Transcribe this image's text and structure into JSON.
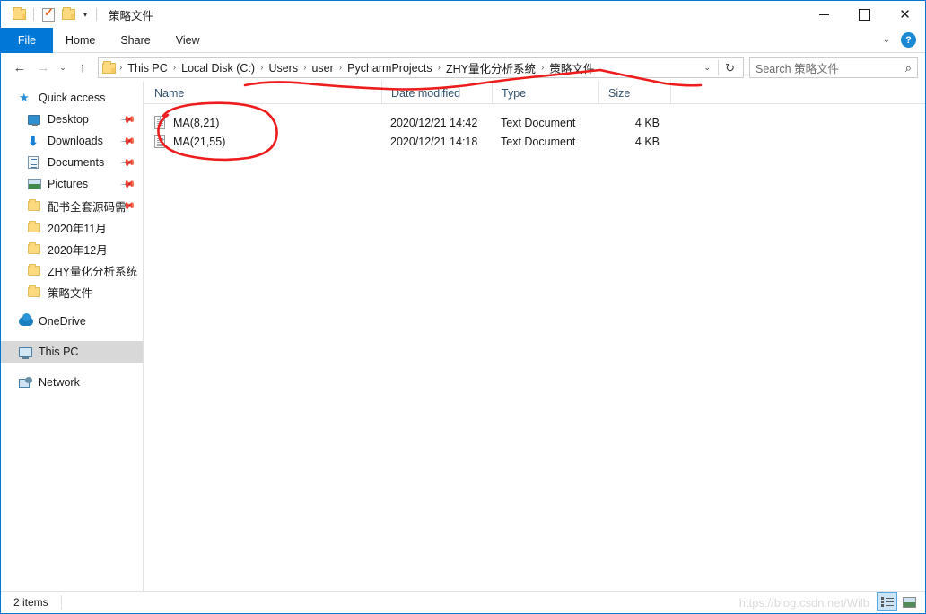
{
  "window": {
    "title": "策略文件",
    "quick_access": [
      "folder-icon",
      "properties-icon",
      "new-folder-icon",
      "dropdown-caret"
    ],
    "controls": {
      "minimize": "−",
      "maximize": "□",
      "close": "✕"
    }
  },
  "ribbon": {
    "tabs": [
      {
        "label": "File",
        "active": true
      },
      {
        "label": "Home",
        "active": false
      },
      {
        "label": "Share",
        "active": false
      },
      {
        "label": "View",
        "active": false
      }
    ],
    "expand_caret": "⌄",
    "help_label": "?"
  },
  "navigation": {
    "back": "←",
    "forward": "→",
    "recent": "⌄",
    "up": "↑",
    "breadcrumbs": [
      "This PC",
      "Local Disk (C:)",
      "Users",
      "user",
      "PycharmProjects",
      "ZHY量化分析系统",
      "策略文件"
    ],
    "separator": "›",
    "dropdown_caret": "⌄",
    "refresh": "↻"
  },
  "search": {
    "placeholder": "Search 策略文件",
    "icon": "search-icon"
  },
  "sidebar": {
    "items": [
      {
        "label": "Quick access",
        "icon": "star-icon",
        "indent": false,
        "pinned": false,
        "selected": false
      },
      {
        "label": "Desktop",
        "icon": "desktop-icon",
        "indent": true,
        "pinned": true,
        "selected": false
      },
      {
        "label": "Downloads",
        "icon": "downloads-icon",
        "indent": true,
        "pinned": true,
        "selected": false
      },
      {
        "label": "Documents",
        "icon": "documents-icon",
        "indent": true,
        "pinned": true,
        "selected": false
      },
      {
        "label": "Pictures",
        "icon": "pictures-icon",
        "indent": true,
        "pinned": true,
        "selected": false
      },
      {
        "label": "配书全套源码需",
        "icon": "folder-icon",
        "indent": true,
        "pinned": true,
        "selected": false
      },
      {
        "label": "2020年11月",
        "icon": "folder-icon",
        "indent": true,
        "pinned": false,
        "selected": false
      },
      {
        "label": "2020年12月",
        "icon": "folder-icon",
        "indent": true,
        "pinned": false,
        "selected": false
      },
      {
        "label": "ZHY量化分析系统",
        "icon": "folder-icon",
        "indent": true,
        "pinned": false,
        "selected": false
      },
      {
        "label": "策略文件",
        "icon": "folder-icon",
        "indent": true,
        "pinned": false,
        "selected": false
      },
      {
        "label": "OneDrive",
        "icon": "onedrive-icon",
        "indent": false,
        "pinned": false,
        "selected": false
      },
      {
        "label": "This PC",
        "icon": "this-pc-icon",
        "indent": false,
        "pinned": false,
        "selected": true
      },
      {
        "label": "Network",
        "icon": "network-icon",
        "indent": false,
        "pinned": false,
        "selected": false
      }
    ]
  },
  "filelist": {
    "columns": [
      "Name",
      "Date modified",
      "Type",
      "Size"
    ],
    "rows": [
      {
        "name": "MA(8,21)",
        "date": "2020/12/21 14:42",
        "type": "Text Document",
        "size": "4 KB",
        "icon": "text-document-icon"
      },
      {
        "name": "MA(21,55)",
        "date": "2020/12/21 14:18",
        "type": "Text Document",
        "size": "4 KB",
        "icon": "text-document-icon"
      }
    ]
  },
  "status": {
    "item_count": "2 items",
    "watermark": "https://blog.csdn.net/Wilb",
    "view_buttons": [
      {
        "name": "details-view",
        "active": true
      },
      {
        "name": "large-icons-view",
        "active": false
      }
    ]
  },
  "annotations": {
    "ink_color": "#ee1c1c",
    "marks": [
      {
        "name": "underline-path",
        "shape": "wavy-line-under-address-bar"
      },
      {
        "name": "circle-files",
        "shape": "oval-around-file-names"
      }
    ]
  }
}
